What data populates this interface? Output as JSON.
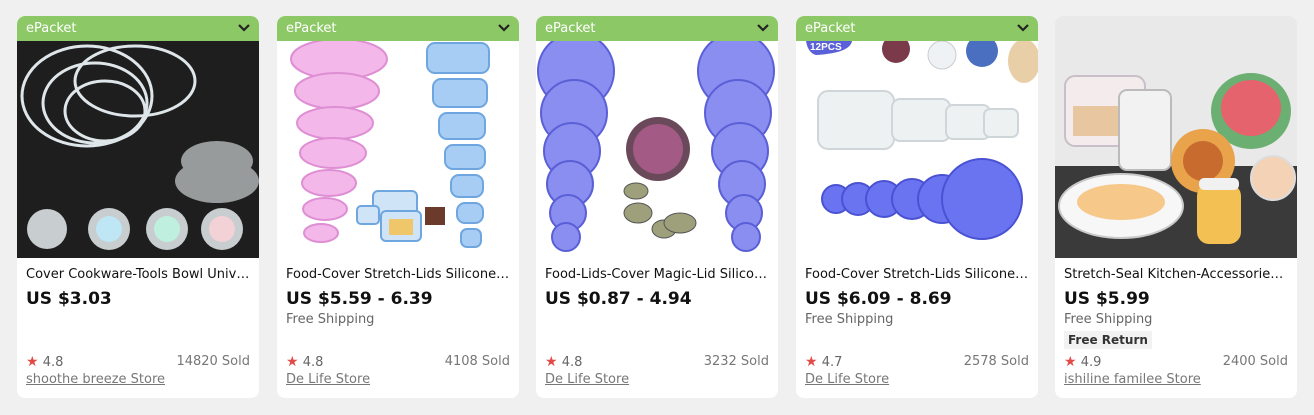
{
  "cards": [
    {
      "badge": "ePacket",
      "title": "Cover Cookware-Tools Bowl Unive...",
      "price": "US $3.03",
      "shipping": "",
      "return_badge": "",
      "rating": "4.8",
      "sold": "14820 Sold",
      "store": "shoothe breeze Store"
    },
    {
      "badge": "ePacket",
      "title": "Food-Cover Stretch-Lids Silicone-C...",
      "price": "US $5.59 - 6.39",
      "shipping": "Free Shipping",
      "return_badge": "",
      "rating": "4.8",
      "sold": "4108 Sold",
      "store": "De Life Store"
    },
    {
      "badge": "ePacket",
      "title": "Food-Lids-Cover Magic-Lid Silicone...",
      "price": "US $0.87 - 4.94",
      "shipping": "",
      "return_badge": "",
      "rating": "4.8",
      "sold": "3232 Sold",
      "store": "De Life Store"
    },
    {
      "badge": "ePacket",
      "image_text": "12PCS",
      "title": "Food-Cover Stretch-Lids Silicone-C...",
      "price": "US $6.09 - 8.69",
      "shipping": "Free Shipping",
      "return_badge": "",
      "rating": "4.7",
      "sold": "2578 Sold",
      "store": "De Life Store"
    },
    {
      "badge": "",
      "title": "Stretch-Seal Kitchen-Accessories F...",
      "price": "US $5.99",
      "shipping": "Free Shipping",
      "return_badge": "Free Return",
      "rating": "4.9",
      "sold": "2400 Sold",
      "store": "ishiline familee Store"
    }
  ],
  "colors": {
    "badge_green": "#8dc866",
    "star_red": "#e24a4a",
    "background": "#f0f0f0"
  },
  "icons": {
    "rating": "star-icon",
    "badge_toggle": "chevron-down-icon"
  }
}
